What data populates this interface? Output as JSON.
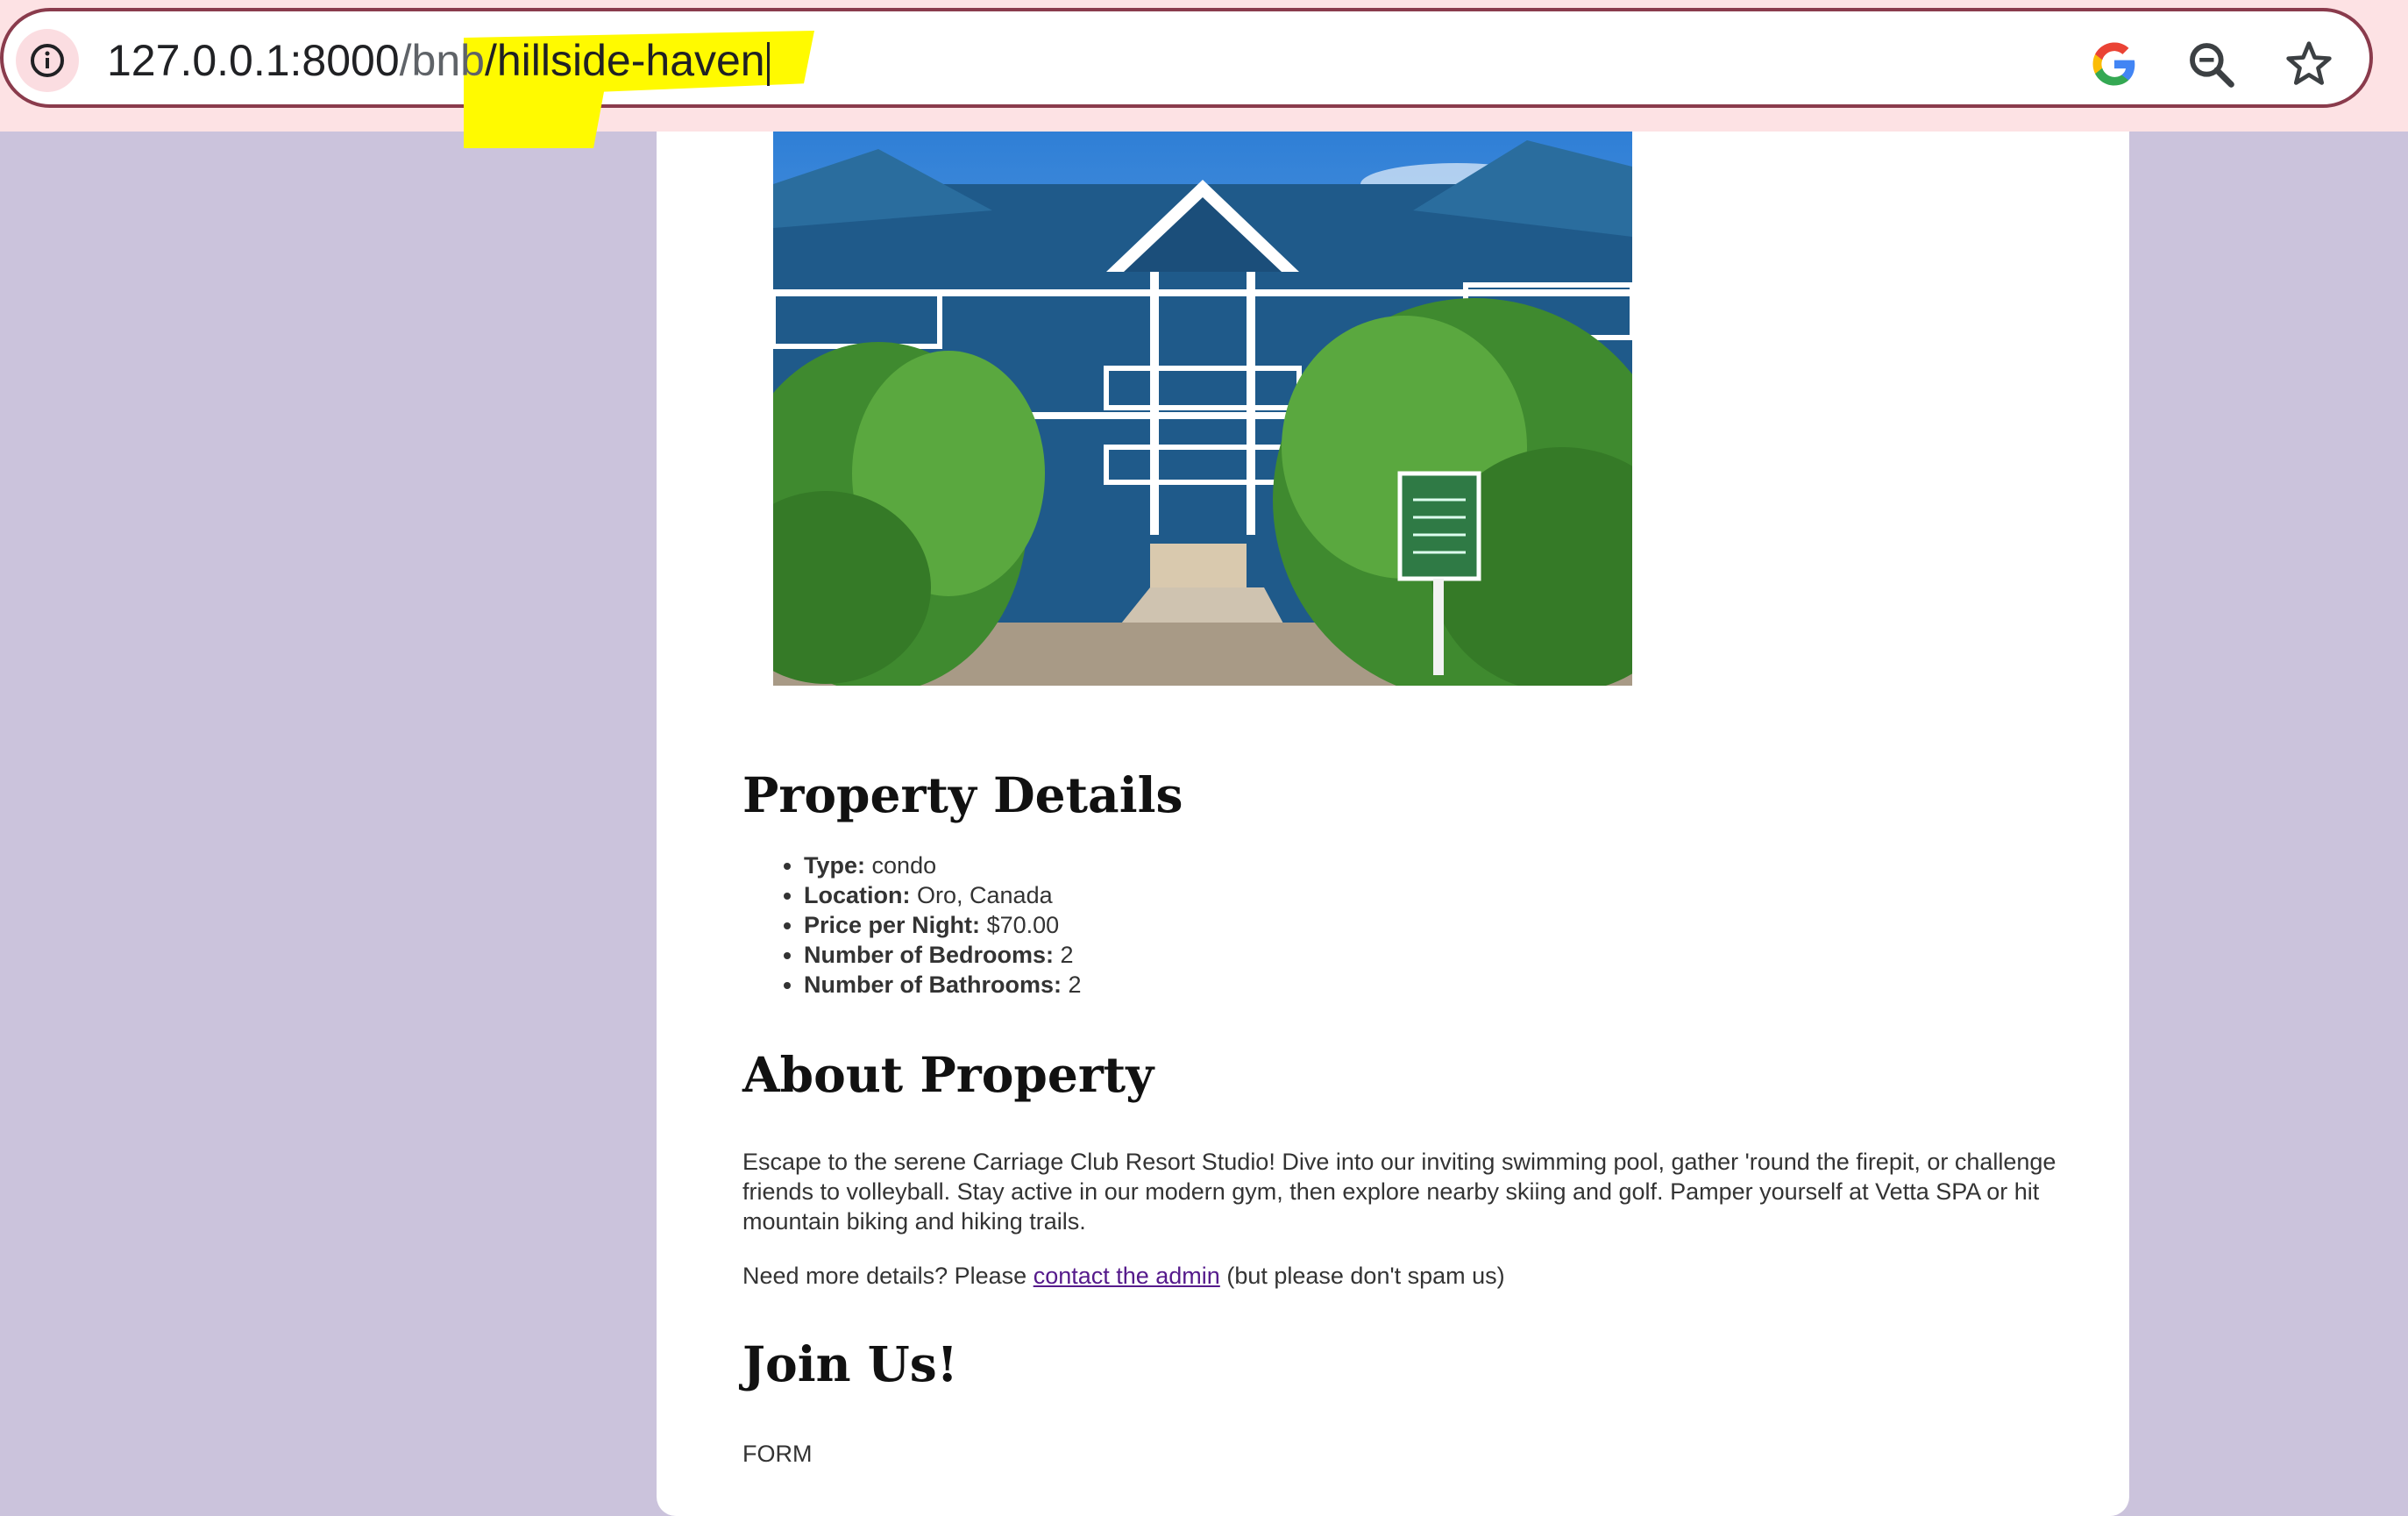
{
  "browser": {
    "url_host": "127.0.0.1:8000",
    "url_path": "/bnb",
    "url_slug": "/hillside-haven",
    "icons": [
      "info-icon",
      "google-icon",
      "zoom-out-icon",
      "bookmark-star-icon"
    ],
    "highlight_color": "#fffa00"
  },
  "property": {
    "details_heading": "Property Details",
    "details": [
      {
        "label": "Type:",
        "value": "condo"
      },
      {
        "label": "Location:",
        "value": "Oro, Canada"
      },
      {
        "label": "Price per Night:",
        "value": "$70.00"
      },
      {
        "label": "Number of Bedrooms:",
        "value": "2"
      },
      {
        "label": "Number of Bathrooms:",
        "value": "2"
      }
    ],
    "about_heading": "About Property",
    "about_text": "Escape to the serene Carriage Club Resort Studio! Dive into our inviting swimming pool, gather 'round the firepit, or challenge friends to volleyball. Stay active in our modern gym, then explore nearby skiing and golf. Pamper yourself at Vetta SPA or hit mountain biking and hiking trails.",
    "contact_prefix": "Need more details? Please ",
    "contact_link": "contact the admin",
    "contact_suffix": " (but please don't spam us)",
    "join_heading": "Join Us!",
    "form_placeholder": "FORM"
  },
  "colors": {
    "page_background": "#cbc3dc",
    "link_visited": "#551a8b"
  }
}
